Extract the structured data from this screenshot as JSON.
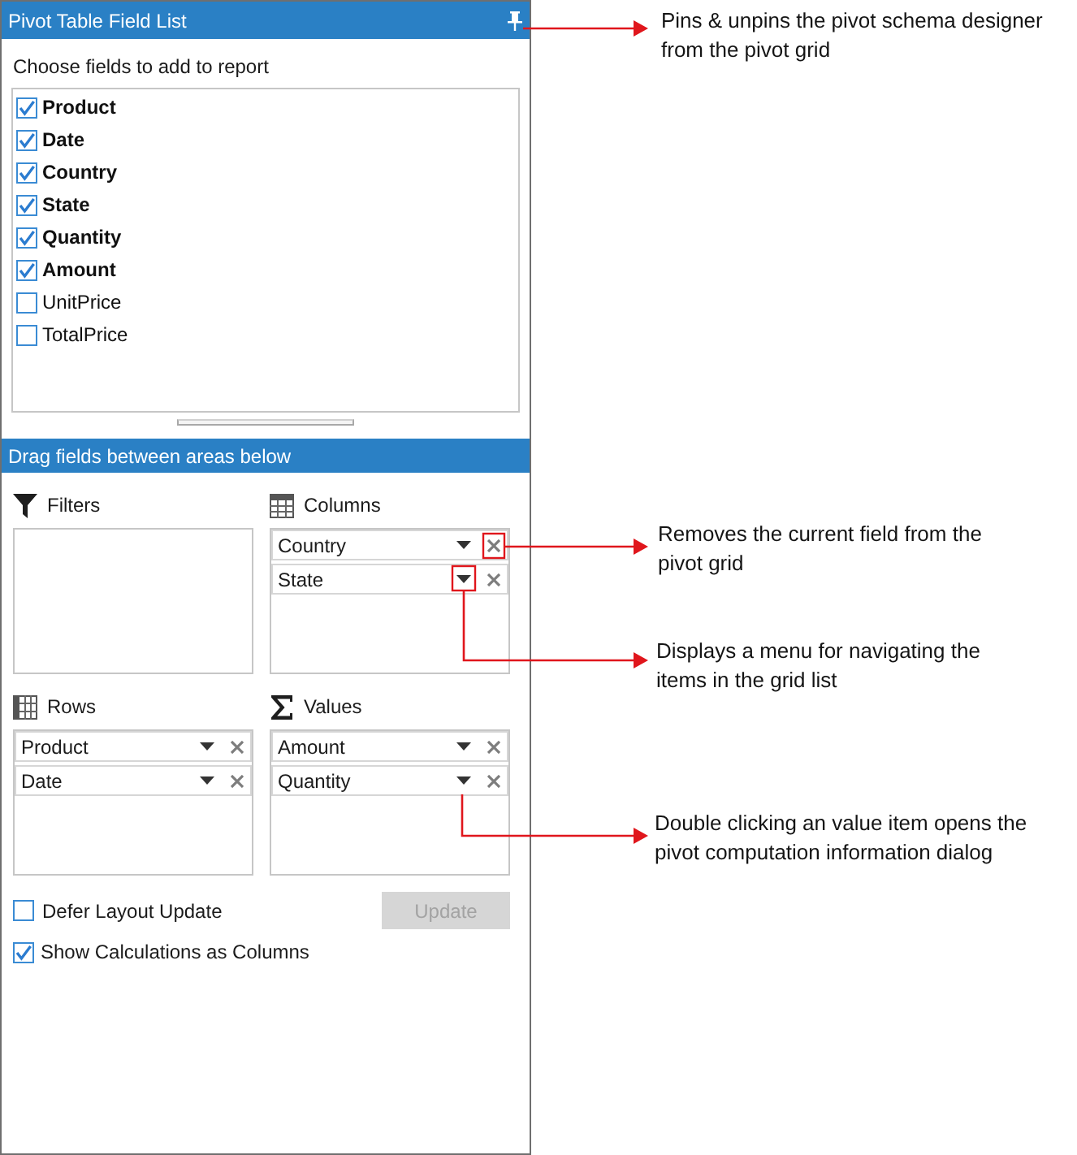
{
  "panel": {
    "title": "Pivot Table Field List"
  },
  "field_list": {
    "label": "Choose fields to add to report",
    "fields": [
      {
        "name": "Product",
        "checked": true
      },
      {
        "name": "Date",
        "checked": true
      },
      {
        "name": "Country",
        "checked": true
      },
      {
        "name": "State",
        "checked": true
      },
      {
        "name": "Quantity",
        "checked": true
      },
      {
        "name": "Amount",
        "checked": true
      },
      {
        "name": "UnitPrice",
        "checked": false
      },
      {
        "name": "TotalPrice",
        "checked": false
      }
    ]
  },
  "areas_header": {
    "title": "Drag fields between areas below"
  },
  "areas": [
    {
      "kind": "filters",
      "label": "Filters"
    },
    {
      "kind": "columns",
      "label": "Columns",
      "items": [
        "Country",
        "State"
      ]
    },
    {
      "kind": "rows",
      "label": "Rows",
      "items": [
        "Product",
        "Date"
      ]
    },
    {
      "kind": "values",
      "label": "Values",
      "items": [
        "Amount",
        "Quantity"
      ]
    }
  ],
  "options": [
    {
      "label": "Defer Layout Update",
      "checked": false
    },
    {
      "label": "Show Calculations as Columns",
      "checked": true
    }
  ],
  "update_button": {
    "label": "Update",
    "disabled": true
  },
  "callouts": [
    {
      "kind": "pin",
      "lines": [
        "Pins & unpins the pivot schema designer",
        "from the pivot grid"
      ]
    },
    {
      "kind": "remove",
      "lines": [
        "Removes the current field from the",
        "pivot grid"
      ]
    },
    {
      "kind": "menu",
      "lines": [
        "Displays a menu for navigating the",
        "items in the grid list"
      ]
    },
    {
      "kind": "value",
      "lines": [
        "Double clicking an value item opens the",
        "pivot computation information dialog"
      ]
    }
  ]
}
